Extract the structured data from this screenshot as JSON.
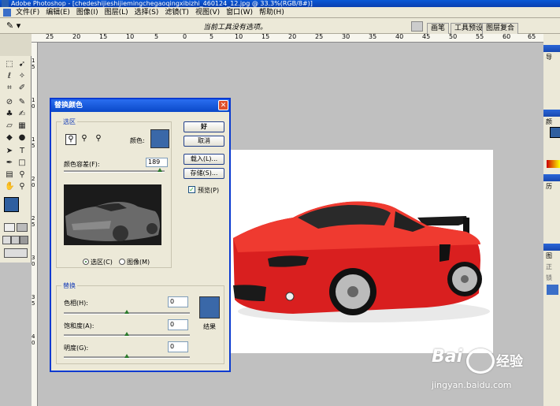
{
  "app": {
    "title": "Adobe Photoshop - [chedeshijieshijiemingchegaoqingxibizhi_460124_12.jpg @ 33.3%(RGB/8#)]"
  },
  "menu": [
    "文件(F)",
    "编辑(E)",
    "图像(I)",
    "图层(L)",
    "选择(S)",
    "滤镜(T)",
    "视图(V)",
    "窗口(W)",
    "帮助(H)"
  ],
  "options_bar": {
    "hint": "当前工具没有选项。",
    "tabs": [
      "画笔",
      "工具预设",
      "图层复合"
    ]
  },
  "ruler_top": [
    "25",
    "20",
    "15",
    "10",
    "5",
    "0",
    "5",
    "10",
    "15",
    "20",
    "25",
    "30",
    "35",
    "40",
    "45",
    "50",
    "55",
    "60",
    "65"
  ],
  "ruler_left": [
    "1",
    "5",
    "1",
    "0",
    "1",
    "5",
    "2",
    "0",
    "2",
    "5",
    "3",
    "0",
    "3",
    "5",
    "4",
    "0"
  ],
  "right_palette": {
    "labels": [
      "导",
      "颜",
      "历",
      "图",
      "正",
      "锁"
    ]
  },
  "dialog": {
    "title": "替换颜色",
    "selection": {
      "group_label": "选区",
      "color_label": "颜色:",
      "color_value": "#3a68a8",
      "tolerance_label": "颜色容差(F):",
      "tolerance_value": "189",
      "tolerance_fraction": 0.95,
      "radio_selection": "选区(C)",
      "radio_image": "图像(M)",
      "selected_radio": "selection"
    },
    "buttons": {
      "ok": "好",
      "cancel": "取消",
      "load": "载入(L)...",
      "save": "存储(S)...",
      "preview": "预览(P)",
      "preview_checked": true
    },
    "replacement": {
      "group_label": "替换",
      "hue_label": "色相(H):",
      "hue_value": "0",
      "saturation_label": "饱和度(A):",
      "saturation_value": "0",
      "lightness_label": "明度(G):",
      "lightness_value": "0",
      "result_label": "结果",
      "result_color": "#3a68a8"
    }
  },
  "watermark": {
    "brand": "Bai",
    "brand_suffix": "经验",
    "url": "jingyan.baidu.com"
  }
}
